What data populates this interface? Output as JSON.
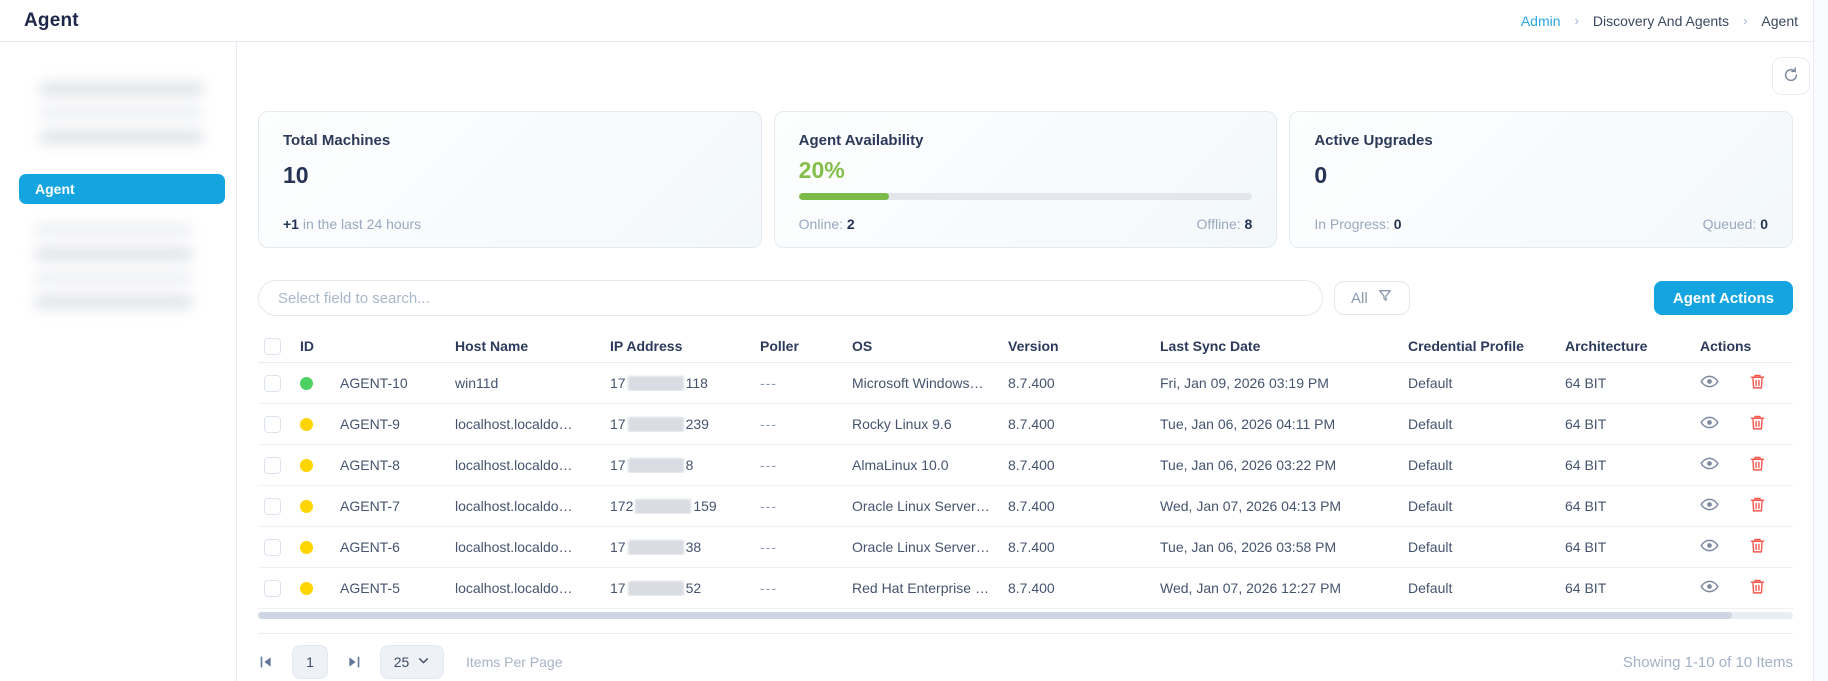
{
  "header": {
    "title": "Agent",
    "breadcrumb": [
      {
        "label": "Admin",
        "link": true
      },
      {
        "label": "Discovery And Agents",
        "link": false
      },
      {
        "label": "Agent",
        "link": false
      }
    ]
  },
  "sidebar": {
    "active_item_label": "Agent"
  },
  "cards": {
    "total_machines": {
      "title": "Total Machines",
      "value": "10",
      "delta": "+1",
      "delta_text": " in the last 24 hours"
    },
    "agent_availability": {
      "title": "Agent Availability",
      "value": "20%",
      "percent": 20,
      "online_label": "Online: ",
      "online_value": "2",
      "offline_label": "Offline: ",
      "offline_value": "8"
    },
    "active_upgrades": {
      "title": "Active Upgrades",
      "value": "0",
      "in_progress_label": "In Progress: ",
      "in_progress_value": "0",
      "queued_label": "Queued: ",
      "queued_value": "0"
    }
  },
  "toolbar": {
    "search_placeholder": "Select field to search...",
    "filter_label": "All",
    "agent_actions_label": "Agent Actions"
  },
  "table": {
    "columns": [
      "ID",
      "Host Name",
      "IP Address",
      "Poller",
      "OS",
      "Version",
      "Last Sync Date",
      "Credential Profile",
      "Architecture",
      "Actions"
    ],
    "rows": [
      {
        "id": "AGENT-10",
        "status": "online",
        "host": "win11d",
        "ip_prefix": "17",
        "ip_suffix": "118",
        "poller": "---",
        "os": "Microsoft Windows…",
        "version": "8.7.400",
        "last_sync": "Fri, Jan 09, 2026 03:19 PM",
        "credential_profile": "Default",
        "architecture": "64 BIT"
      },
      {
        "id": "AGENT-9",
        "status": "warning",
        "host": "localhost.localdo…",
        "ip_prefix": "17",
        "ip_suffix": "239",
        "poller": "---",
        "os": "Rocky Linux 9.6",
        "version": "8.7.400",
        "last_sync": "Tue, Jan 06, 2026 04:11 PM",
        "credential_profile": "Default",
        "architecture": "64 BIT"
      },
      {
        "id": "AGENT-8",
        "status": "warning",
        "host": "localhost.localdo…",
        "ip_prefix": "17",
        "ip_suffix": "8",
        "poller": "---",
        "os": "AlmaLinux 10.0",
        "version": "8.7.400",
        "last_sync": "Tue, Jan 06, 2026 03:22 PM",
        "credential_profile": "Default",
        "architecture": "64 BIT"
      },
      {
        "id": "AGENT-7",
        "status": "warning",
        "host": "localhost.localdo…",
        "ip_prefix": "172",
        "ip_suffix": "159",
        "poller": "---",
        "os": "Oracle Linux Server…",
        "version": "8.7.400",
        "last_sync": "Wed, Jan 07, 2026 04:13 PM",
        "credential_profile": "Default",
        "architecture": "64 BIT"
      },
      {
        "id": "AGENT-6",
        "status": "warning",
        "host": "localhost.localdo…",
        "ip_prefix": "17",
        "ip_suffix": "38",
        "poller": "---",
        "os": "Oracle Linux Server…",
        "version": "8.7.400",
        "last_sync": "Tue, Jan 06, 2026 03:58 PM",
        "credential_profile": "Default",
        "architecture": "64 BIT"
      },
      {
        "id": "AGENT-5",
        "status": "warning",
        "host": "localhost.localdo…",
        "ip_prefix": "17",
        "ip_suffix": "52",
        "poller": "---",
        "os": "Red Hat Enterprise …",
        "version": "8.7.400",
        "last_sync": "Wed, Jan 07, 2026 12:27 PM",
        "credential_profile": "Default",
        "architecture": "64 BIT"
      }
    ]
  },
  "pagination": {
    "page": "1",
    "per_page": "25",
    "items_per_page_label": "Items Per Page",
    "summary": "Showing 1-10 of 10 Items"
  },
  "icons": {
    "refresh-icon": "↻",
    "filter-funnel-icon": "▽",
    "chevron-down-icon": "⌄",
    "first-page-icon": "|◀",
    "last-page-icon": "▶|",
    "eye-icon": "view",
    "trash-icon": "delete",
    "breadcrumb-separator": "›"
  },
  "colors": {
    "accent_blue": "#14a5e0",
    "link_blue": "#2ba6e3",
    "status_online": "#4ed164",
    "status_warning": "#ffd500",
    "success_green": "#7cbb47",
    "danger_red": "#f4584e"
  }
}
